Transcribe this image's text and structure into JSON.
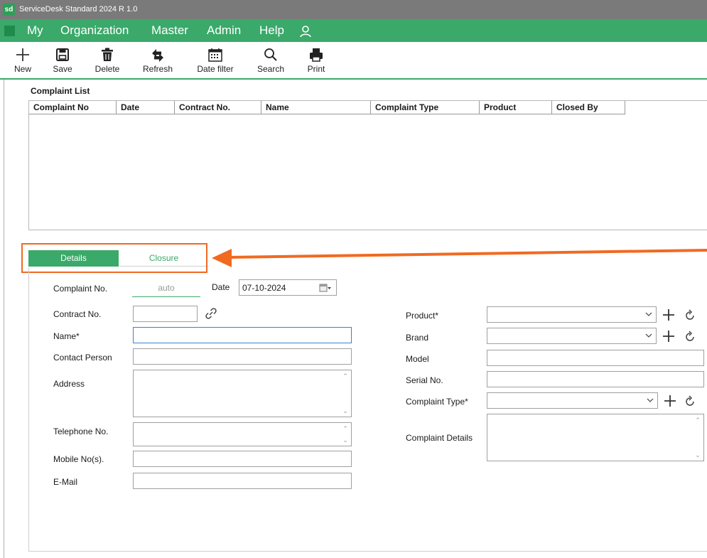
{
  "window": {
    "logo_text": "sd",
    "title": "ServiceDesk Standard 2024 R 1.0"
  },
  "menu": {
    "items": [
      "My",
      "Organization",
      "Master",
      "Admin",
      "Help"
    ],
    "user_icon": "user-icon"
  },
  "toolbar": {
    "new_label": "New",
    "save_label": "Save",
    "delete_label": "Delete",
    "refresh_label": "Refresh",
    "date_filter_label": "Date filter",
    "search_label": "Search",
    "print_label": "Print"
  },
  "complaint_list": {
    "title": "Complaint List",
    "columns": [
      "Complaint No",
      "Date",
      "Contract No.",
      "Name",
      "Complaint Type",
      "Product",
      "Closed By"
    ],
    "rows": []
  },
  "tabs": {
    "details": "Details",
    "closure": "Closure"
  },
  "form": {
    "complaint_no_label": "Complaint No.",
    "complaint_no_value": "auto",
    "date_label": "Date",
    "date_value": "07-10-2024",
    "contract_no_label": "Contract No.",
    "name_label": "Name*",
    "contact_person_label": "Contact Person",
    "address_label": "Address",
    "telephone_label": "Telephone No.",
    "mobile_label": "Mobile No(s).",
    "email_label": "E-Mail",
    "product_label": "Product*",
    "brand_label": "Brand",
    "model_label": "Model",
    "serial_label": "Serial No.",
    "complaint_type_label": "Complaint Type*",
    "complaint_details_label": "Complaint Details"
  },
  "colors": {
    "accent": "#3aa96a",
    "highlight": "#f06a22",
    "titlebar": "#7a7a7a"
  }
}
